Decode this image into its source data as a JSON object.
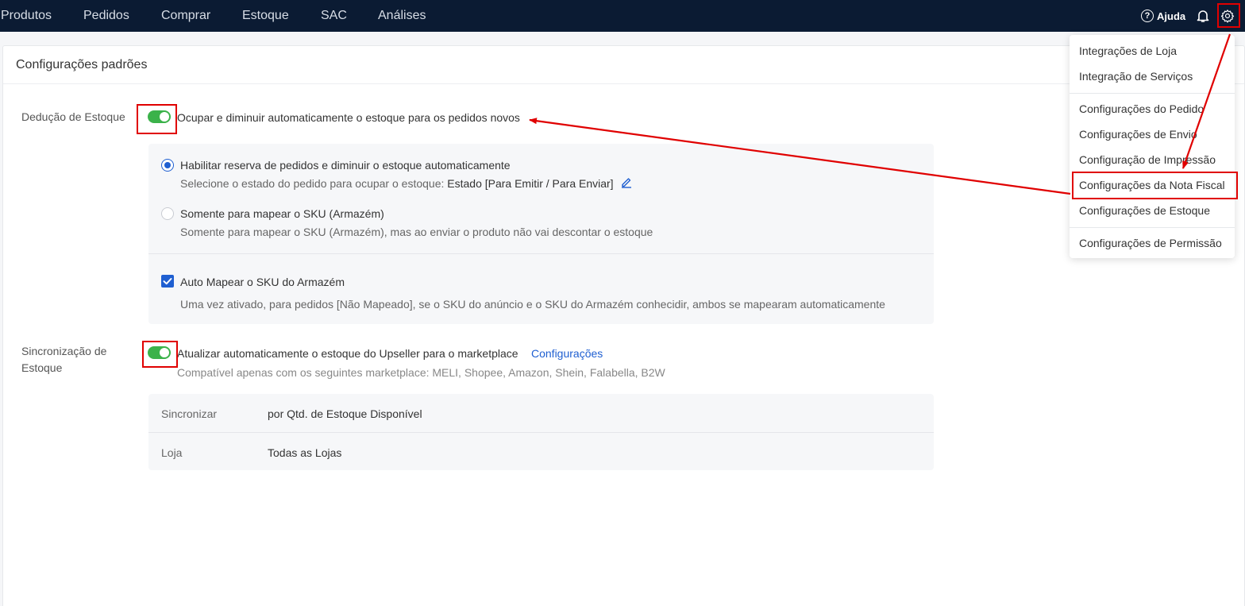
{
  "nav": {
    "items": [
      "Produtos",
      "Pedidos",
      "Comprar",
      "Estoque",
      "SAC",
      "Análises"
    ],
    "help_label": "Ajuda",
    "help_glyph": "?",
    "icons": {
      "help": "help-circle-icon",
      "bell": "bell-icon",
      "gear": "gear-icon"
    }
  },
  "page": {
    "title": "Configurações padrões"
  },
  "deduction": {
    "label": "Dedução de Estoque",
    "toggle_on": true,
    "main_text": "Ocupar e diminuir automaticamente o estoque para os pedidos novos",
    "option1_label": "Habilitar reserva de pedidos e diminuir o estoque automaticamente",
    "option1_desc_prefix": "Selecione o estado do pedido para ocupar o estoque:",
    "option1_desc_value": "Estado [Para Emitir / Para Enviar]",
    "option1_selected": true,
    "option2_label": "Somente para mapear o SKU (Armazém)",
    "option2_desc": "Somente para mapear o SKU (Armazém), mas ao enviar o produto não vai descontar o estoque",
    "option2_selected": false,
    "automap_label": "Auto Mapear o SKU do Armazém",
    "automap_checked": true,
    "automap_desc": "Uma vez ativado, para pedidos [Não Mapeado], se o SKU do anúncio e o SKU do Armazém conhecidir, ambos se mapearam automaticamente"
  },
  "sync": {
    "label_line1": "Sincronização de",
    "label_line2": "Estoque",
    "toggle_on": true,
    "main_text": "Atualizar automaticamente o estoque do Upseller para o marketplace",
    "config_link": "Configurações",
    "compat_text": "Compatível apenas com os seguintes marketplace: MELI, Shopee, Amazon, Shein, Falabella, B2W",
    "rows": [
      {
        "key": "Sincronizar",
        "value": "por Qtd. de Estoque Disponível"
      },
      {
        "key": "Loja",
        "value": "Todas as Lojas"
      }
    ]
  },
  "dropdown": {
    "items": [
      "Integrações de Loja",
      "Integração de Serviços",
      "Configurações do Pedido",
      "Configurações de Envio",
      "Configuração de Impressão",
      "Configurações da Nota Fiscal",
      "Configurações de Estoque",
      "Configurações de Permissão"
    ]
  },
  "colors": {
    "nav_bg": "#0b1b33",
    "toggle_on": "#3bb24a",
    "link": "#1f5fd1",
    "annotation": "#e00000"
  }
}
